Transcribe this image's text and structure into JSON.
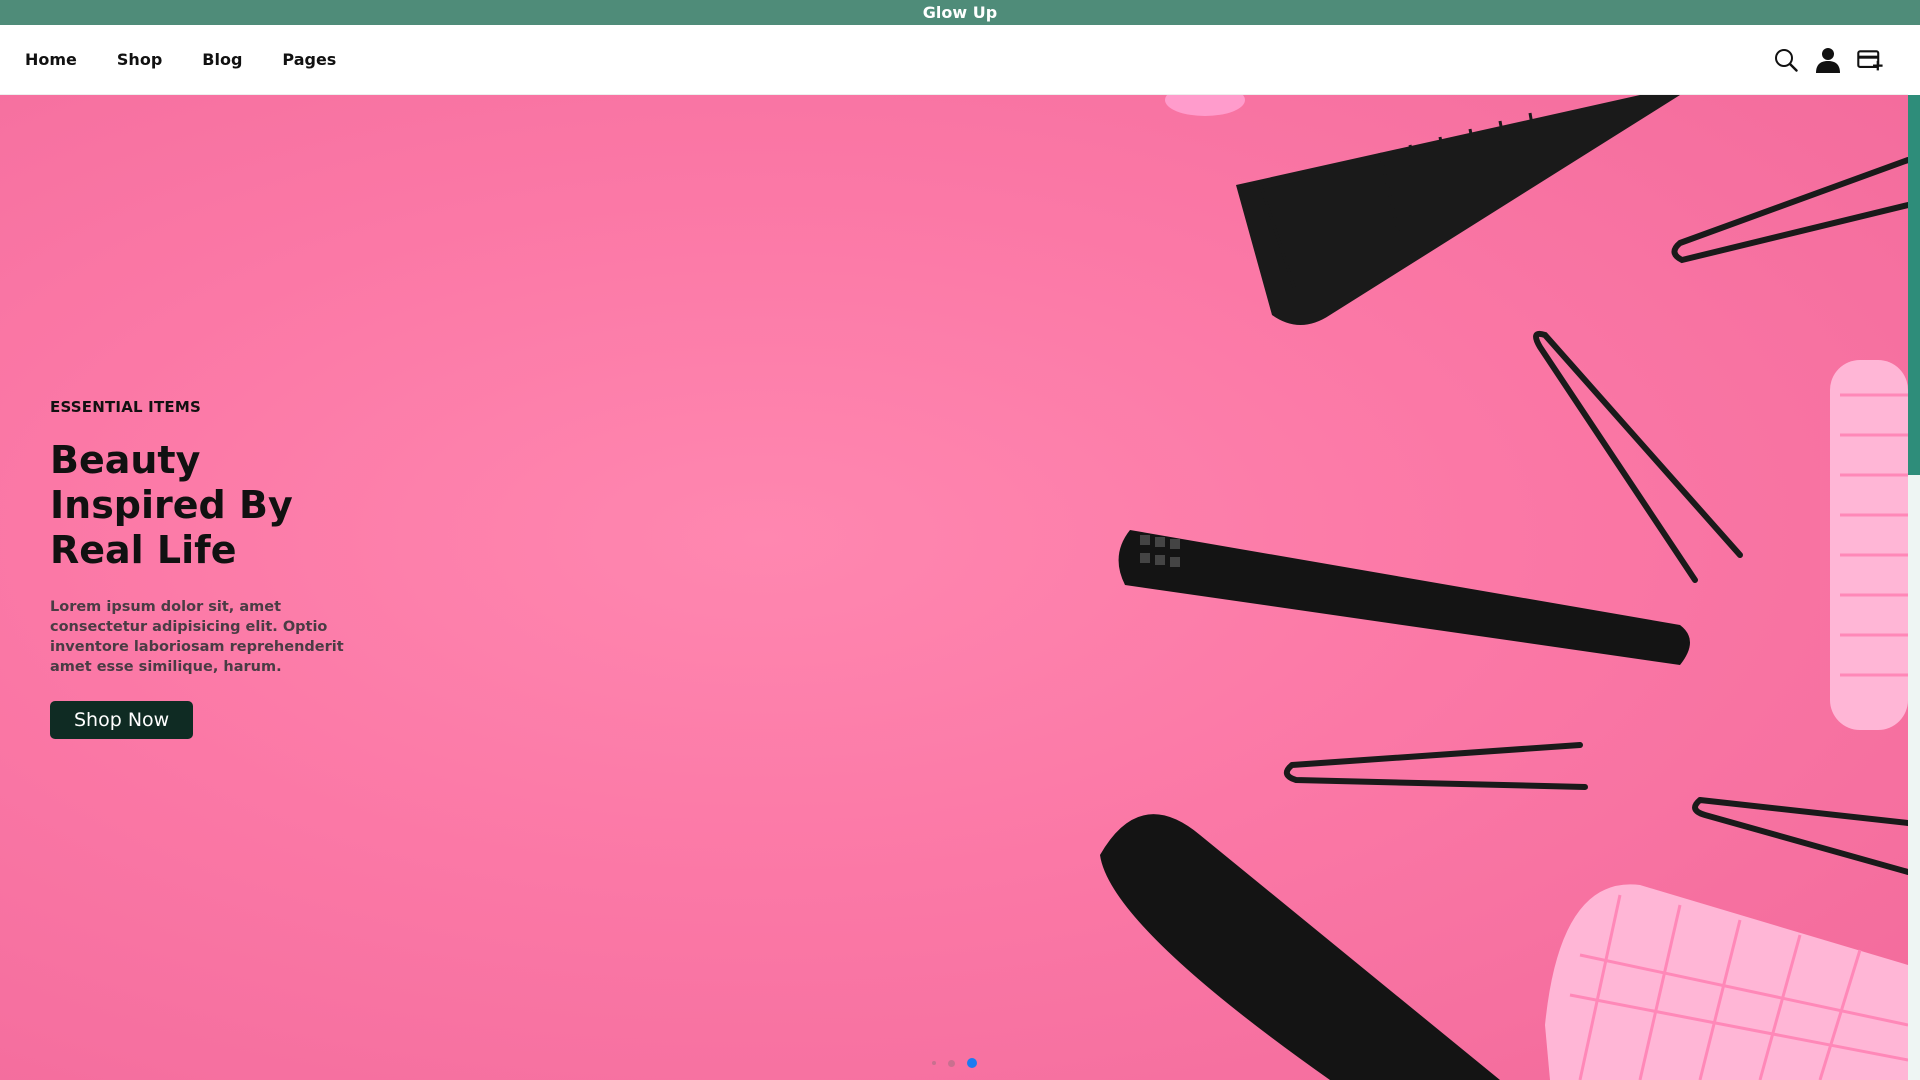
{
  "topbar": {
    "brand": "Glow Up"
  },
  "nav": {
    "links": [
      {
        "label": "Home"
      },
      {
        "label": "Shop"
      },
      {
        "label": "Blog"
      },
      {
        "label": "Pages"
      }
    ],
    "icons": [
      "search-icon",
      "user-icon",
      "cart-icon"
    ]
  },
  "hero": {
    "eyebrow": "ESSENTIAL ITEMS",
    "title": "Beauty Inspired By Real Life",
    "description": "Lorem ipsum dolor sit, amet consectetur adipisicing elit. Optio inventore laboriosam reprehenderit amet esse similique, harum.",
    "button_label": "Shop Now",
    "active_slide": 3,
    "slide_count": 3
  },
  "colors": {
    "topbar": "#4f8c79",
    "hero_background": "#fb78a6",
    "button": "#0f2b23",
    "active_dot": "#1c7bf0",
    "scrollbar_thumb": "#2e8d7a"
  }
}
